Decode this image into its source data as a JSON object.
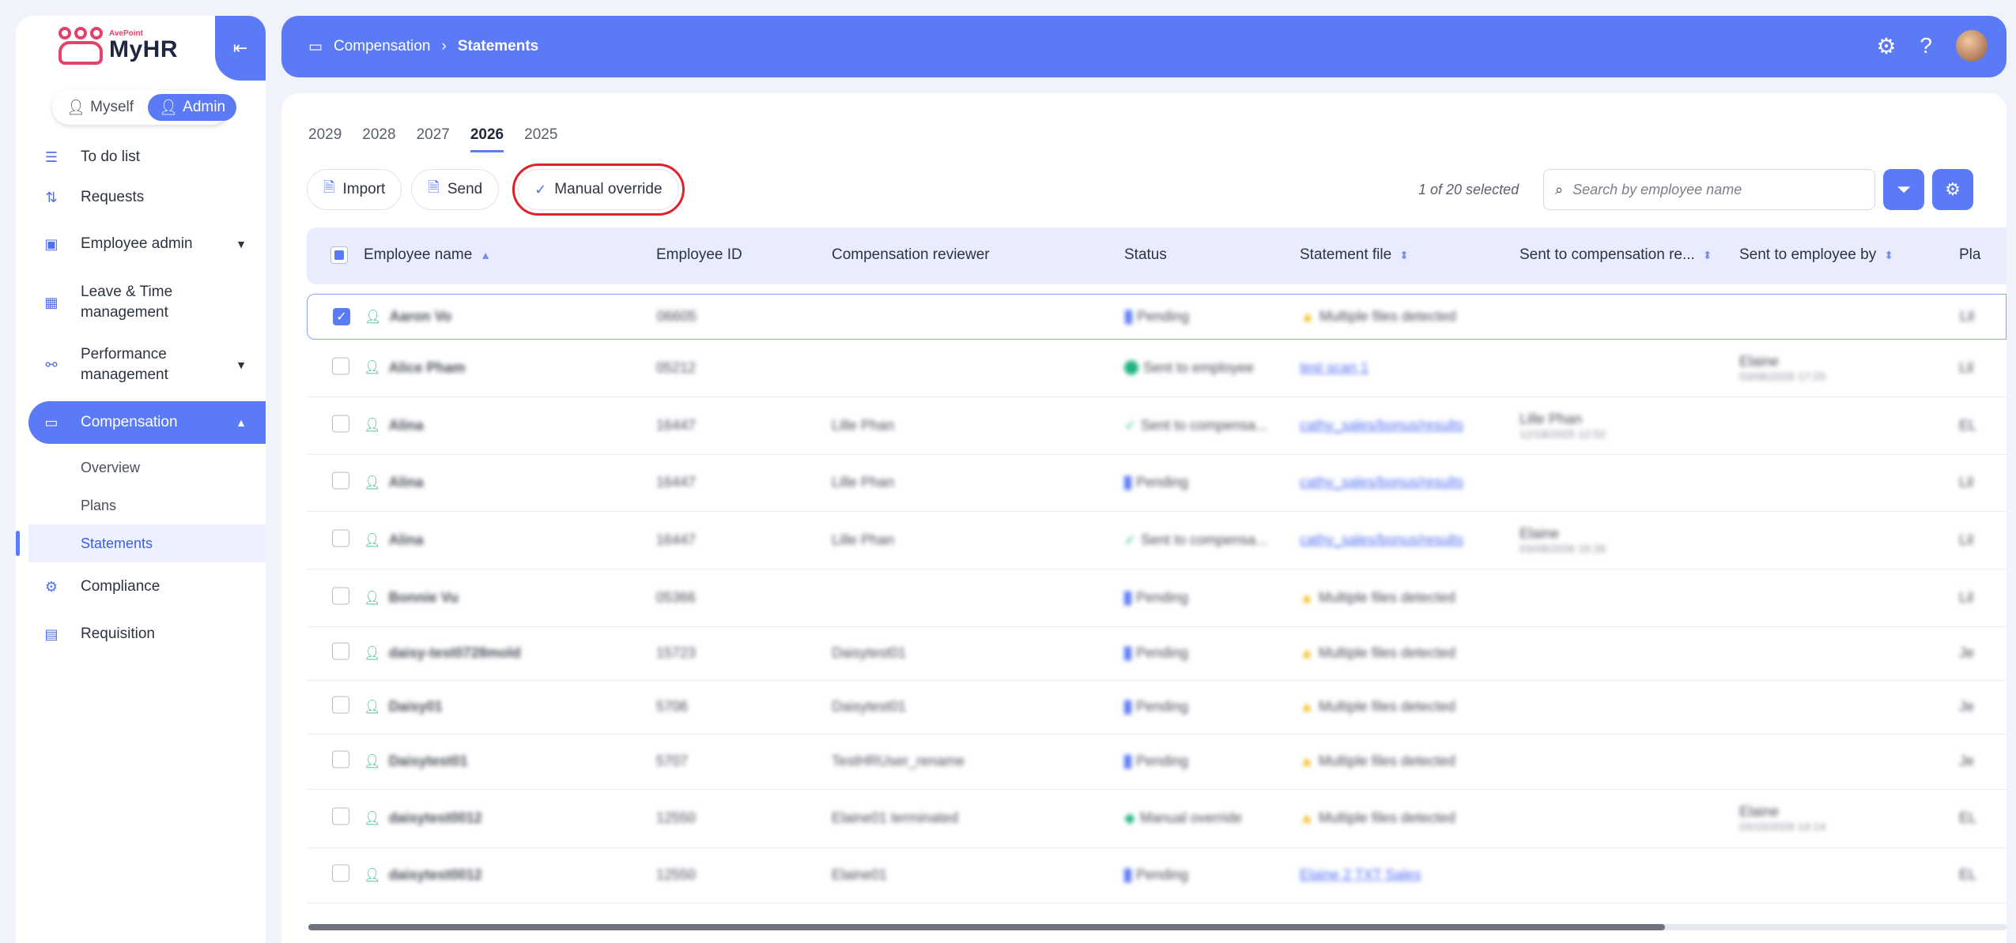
{
  "app": {
    "brand_small": "AvePoint",
    "brand_name": "MyHR"
  },
  "role_toggle": {
    "myself": "Myself",
    "admin": "Admin"
  },
  "nav": {
    "todo": "To do list",
    "requests": "Requests",
    "employee_admin": "Employee admin",
    "leave_time": "Leave & Time management",
    "performance": "Performance management",
    "compensation": "Compensation",
    "sub_overview": "Overview",
    "sub_plans": "Plans",
    "sub_statements": "Statements",
    "compliance": "Compliance",
    "requisition": "Requisition"
  },
  "breadcrumb": {
    "parent": "Compensation",
    "current": "Statements"
  },
  "years": [
    "2029",
    "2028",
    "2027",
    "2026",
    "2025"
  ],
  "toolbar": {
    "import": "Import",
    "send": "Send",
    "manual_override": "Manual override"
  },
  "selection": "1 of 20 selected",
  "search": {
    "placeholder": "Search by employee name"
  },
  "columns": {
    "name": "Employee name",
    "id": "Employee ID",
    "reviewer": "Compensation reviewer",
    "status": "Status",
    "file": "Statement file",
    "sent_comp": "Sent to compensation re...",
    "sent_emp": "Sent to employee by",
    "plan": "Pla"
  },
  "rows": [
    {
      "name": "Aaron Vo",
      "id": "06605",
      "reviewer": "",
      "status": "Pending",
      "file": "Multiple files detected",
      "sent_comp": "",
      "sent_comp_date": "",
      "sent_emp": "",
      "sent_emp_date": "",
      "plan": "Lil"
    },
    {
      "name": "Alice Pham",
      "id": "05212",
      "reviewer": "",
      "status": "Sent to employee",
      "file": "test scan 1",
      "sent_comp": "",
      "sent_comp_date": "",
      "sent_emp": "Elaine",
      "sent_emp_date": "03/06/2026 17:25",
      "plan": "Lil"
    },
    {
      "name": "Alina",
      "id": "16447",
      "reviewer": "Lille Phan",
      "status": "Sent to compensa...",
      "file": "cathy_sales/bonus/results",
      "sent_comp": "Lille Phan",
      "sent_comp_date": "12/18/2025 12:52",
      "sent_emp": "",
      "sent_emp_date": "",
      "plan": "EL"
    },
    {
      "name": "Alina",
      "id": "16447",
      "reviewer": "Lille Phan",
      "status": "Pending",
      "file": "cathy_sales/bonus/results",
      "sent_comp": "",
      "sent_comp_date": "",
      "sent_emp": "",
      "sent_emp_date": "",
      "plan": "Lil"
    },
    {
      "name": "Alina",
      "id": "16447",
      "reviewer": "Lille Phan",
      "status": "Sent to compensa...",
      "file": "cathy_sales/bonus/results",
      "sent_comp": "Elaine",
      "sent_comp_date": "03/09/2026 15:28",
      "sent_emp": "",
      "sent_emp_date": "",
      "plan": "Lil"
    },
    {
      "name": "Bonnie Vu",
      "id": "05366",
      "reviewer": "",
      "status": "Pending",
      "file": "Multiple files detected",
      "sent_comp": "",
      "sent_comp_date": "",
      "sent_emp": "",
      "sent_emp_date": "",
      "plan": "Lil"
    },
    {
      "name": "daisy-test0728mold",
      "id": "15723",
      "reviewer": "Daisytest01",
      "status": "Pending",
      "file": "Multiple files detected",
      "sent_comp": "",
      "sent_comp_date": "",
      "sent_emp": "",
      "sent_emp_date": "",
      "plan": "Je"
    },
    {
      "name": "Daisy01",
      "id": "5706",
      "reviewer": "Daisytest01",
      "status": "Pending",
      "file": "Multiple files detected",
      "sent_comp": "",
      "sent_comp_date": "",
      "sent_emp": "",
      "sent_emp_date": "",
      "plan": "Je"
    },
    {
      "name": "Daisytest01",
      "id": "5707",
      "reviewer": "TestHRUser_rename",
      "status": "Pending",
      "file": "Multiple files detected",
      "sent_comp": "",
      "sent_comp_date": "",
      "sent_emp": "",
      "sent_emp_date": "",
      "plan": "Je"
    },
    {
      "name": "daisytest0012",
      "id": "12550",
      "reviewer": "Elaine01 terminated",
      "status": "Manual override",
      "file": "Multiple files detected",
      "sent_comp": "",
      "sent_comp_date": "",
      "sent_emp": "Elaine",
      "sent_emp_date": "03/10/2026 14:14",
      "plan": "EL"
    },
    {
      "name": "daisytest0012",
      "id": "12550",
      "reviewer": "Elaine01",
      "status": "Pending",
      "file": "Elaine 2 TXT Sales",
      "sent_comp": "",
      "sent_comp_date": "",
      "sent_emp": "",
      "sent_emp_date": "",
      "plan": "EL"
    }
  ],
  "colors": {
    "accent": "#5b7af6",
    "success": "#1fb37e",
    "warning": "#f4b400",
    "highlight": "#e0212b"
  }
}
